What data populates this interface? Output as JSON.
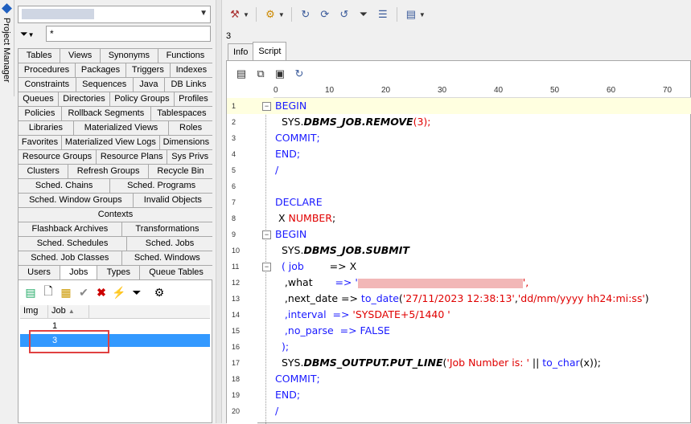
{
  "project_manager_label": "Project Manager",
  "filter": {
    "value": "*"
  },
  "object_tabs": [
    [
      "Tables",
      "Views",
      "Synonyms",
      "Functions"
    ],
    [
      "Procedures",
      "Packages",
      "Triggers",
      "Indexes"
    ],
    [
      "Constraints",
      "Sequences",
      "Java",
      "DB Links"
    ],
    [
      "Queues",
      "Directories",
      "Policy Groups",
      "Profiles"
    ],
    [
      "Policies",
      "Rollback Segments",
      "Tablespaces"
    ],
    [
      "Libraries",
      "Materialized Views",
      "Roles"
    ],
    [
      "Favorites",
      "Materialized View Logs",
      "Dimensions"
    ],
    [
      "Resource Groups",
      "Resource Plans",
      "Sys Privs"
    ],
    [
      "Clusters",
      "Refresh Groups",
      "Recycle Bin"
    ],
    [
      "Sched. Chains",
      "Sched. Programs"
    ],
    [
      "Sched. Window Groups",
      "Invalid Objects"
    ],
    [
      "Contexts"
    ],
    [
      "Flashback Archives",
      "Transformations"
    ],
    [
      "Sched. Schedules",
      "Sched. Jobs"
    ],
    [
      "Sched. Job Classes",
      "Sched. Windows"
    ],
    [
      "Users",
      "Jobs",
      "Types",
      "Queue Tables"
    ]
  ],
  "active_object_tab": "Jobs",
  "grid": {
    "columns": [
      "Img",
      "Job"
    ],
    "rows": [
      {
        "job": "1"
      },
      {
        "job": "3"
      }
    ],
    "selected_job": "3"
  },
  "job_id": "3",
  "editor_tabs": [
    "Info",
    "Script"
  ],
  "active_editor_tab": "Script",
  "ruler_ticks": [
    "0",
    "10",
    "20",
    "30",
    "40",
    "50",
    "60",
    "70"
  ],
  "line_numbers": [
    "1",
    "2",
    "3",
    "4",
    "5",
    "6",
    "7",
    "8",
    "9",
    "10",
    "11",
    "12",
    "13",
    "14",
    "15",
    "16",
    "17",
    "18",
    "19",
    "20"
  ],
  "code": {
    "l1": "BEGIN",
    "l2a": "SYS.",
    "l2b": "DBMS_JOB.REMOVE",
    "l2c": "(3);",
    "l3": "COMMIT;",
    "l4": "END;",
    "l5": "/",
    "l7": "DECLARE",
    "l8a": "X ",
    "l8b": "NUMBER",
    "l8c": ";",
    "l9": "BEGIN",
    "l10a": "SYS.",
    "l10b": "DBMS_JOB.SUBMIT",
    "l11a": "( job",
    "l11b": "=> X",
    "l12a": ",what",
    "l12b": "=> '",
    "l12c": "',",
    "l13a": ",next_date => ",
    "l13b": "to_date",
    "l13c": "(",
    "l13d": "'27/11/2023 12:38:13'",
    "l13e": ",",
    "l13f": "'dd/mm/yyyy hh24:mi:ss'",
    "l13g": ")",
    "l14a": ",interval  => ",
    "l14b": "'SYSDATE+5/1440 '",
    "l15a": ",no_parse  => ",
    "l15b": "FALSE",
    "l16": ");",
    "l17a": "SYS.",
    "l17b": "DBMS_OUTPUT.PUT_LINE",
    "l17c": "(",
    "l17d": "'Job Number is: '",
    "l17e": " || ",
    "l17f": "to_char",
    "l17g": "(x));",
    "l18": "COMMIT;",
    "l19": "END;",
    "l20": "/"
  }
}
